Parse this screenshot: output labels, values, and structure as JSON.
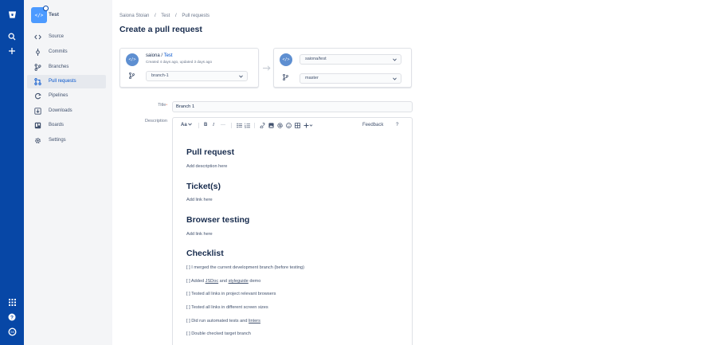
{
  "colors": {
    "global_nav": "#0747a6",
    "sidebar": "#f4f5f7",
    "link": "#0052cc",
    "avatar": "#4c9aff"
  },
  "global_nav": {
    "icons": [
      "bitbucket-logo-icon",
      "search-icon",
      "create-plus-icon",
      "app-switcher-icon",
      "help-icon",
      "user-avatar-icon"
    ]
  },
  "sidebar": {
    "project_avatar": "</>",
    "project_name": "Test",
    "items": [
      {
        "label": "Source",
        "icon": "code-icon"
      },
      {
        "label": "Commits",
        "icon": "commit-icon"
      },
      {
        "label": "Branches",
        "icon": "branch-icon"
      },
      {
        "label": "Pull requests",
        "icon": "pull-request-icon",
        "active": true
      },
      {
        "label": "Pipelines",
        "icon": "pipelines-icon"
      },
      {
        "label": "Downloads",
        "icon": "download-icon"
      },
      {
        "label": "Boards",
        "icon": "board-icon"
      },
      {
        "label": "Settings",
        "icon": "gear-icon"
      }
    ]
  },
  "breadcrumbs": [
    "Saiona Stoian",
    "/",
    "Test",
    "/",
    "Pull requests"
  ],
  "page_title": "Create a pull request",
  "source": {
    "avatar": "</>",
    "owner": "saiona",
    "separator": " / ",
    "repo": "Test",
    "meta": "Created 4 days ago, updated 3 days ago",
    "branch": "branch-1"
  },
  "destination": {
    "avatar": "</>",
    "repo": "saiona/test",
    "branch": "master"
  },
  "form": {
    "title_label": "Title",
    "title_required": "*",
    "title_value": "Branch 1",
    "description_label": "Description"
  },
  "toolbar": {
    "text_style": "Aa",
    "bold": "B",
    "italic": "I",
    "more": "···",
    "feedback": "Feedback",
    "help": "?"
  },
  "description": {
    "h1": "Pull request",
    "p1": "Add description here",
    "h2": "Ticket(s)",
    "p2": "Add link here",
    "h3": "Browser testing",
    "p3": "Add link here",
    "h4": "Checklist",
    "checklist": {
      "c1": "[ ] I merged the current development branch (before testing)",
      "c2_pre": "[ ] Added ",
      "c2_link1": "JSDoc",
      "c2_mid": " and ",
      "c2_link2": "styleguide",
      "c2_post": " demo",
      "c3": "[ ] Tested all links in project relevant browsers",
      "c4": "[ ] Tested all links in different screen sizes",
      "c5_pre": "[ ] Did run automated tests and ",
      "c5_link": "linters",
      "c6": "[ ] Double checked target branch"
    }
  }
}
